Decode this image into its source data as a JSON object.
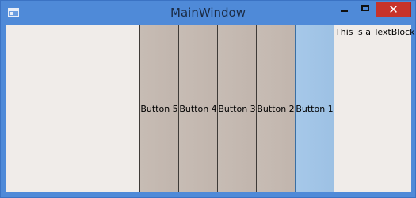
{
  "window": {
    "title": "MainWindow",
    "close_glyph": "✕"
  },
  "icons": {
    "app": "window-app-icon",
    "minimize": "minimize-icon",
    "maximize": "maximize-icon",
    "close": "close-icon"
  },
  "colors": {
    "titlebar": "#4f8ad8",
    "close_button": "#c7332b",
    "client_background": "#f0ece9",
    "button_face": "#c4b9b1",
    "focused_button_face": "#a6c8e9"
  },
  "buttons": [
    {
      "label": "Button 5"
    },
    {
      "label": "Button 4"
    },
    {
      "label": "Button 3"
    },
    {
      "label": "Button 2"
    },
    {
      "label": "Button 1"
    }
  ],
  "textblock": "This is a TextBlock"
}
